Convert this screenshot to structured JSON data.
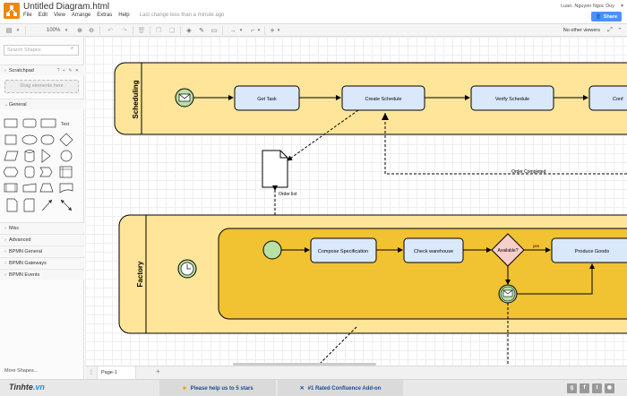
{
  "app": {
    "title": "Untitled Diagram.html",
    "last_change": "Last change less than a minute ago",
    "user": "Luan. Nguyen Ngoc Duy",
    "share_label": "Share",
    "no_viewers": "No other viewers"
  },
  "menu": [
    "File",
    "Edit",
    "View",
    "Arrange",
    "Extras",
    "Help"
  ],
  "toolbar": {
    "zoom": "100%"
  },
  "sidebar": {
    "search_placeholder": "Search Shapes",
    "scratchpad": "Scratchpad",
    "drag_here": "Drag elements here",
    "general": "General",
    "text_shape": "Text",
    "sections": [
      "Misc",
      "Advanced",
      "BPMN General",
      "BPMN Gateways",
      "BPMN Events"
    ],
    "more_shapes": "More Shapes..."
  },
  "diagram": {
    "lanes": [
      "Scheduling",
      "Factory"
    ],
    "tasks": {
      "get_task": "Get Task",
      "create_schedule": "Create Schedule",
      "verify_schedule": "Verify Schedule",
      "confirm": "Conf",
      "compose_spec": "Compose Specification",
      "check_warehouse": "Check warehouse",
      "available": "Available?",
      "produce_goods": "Produce Goods"
    },
    "labels": {
      "order_list": "Order list",
      "order_completed": "Order Completed",
      "yes": "yes"
    }
  },
  "pages": {
    "tab": "Page-1"
  },
  "footer": {
    "brand": "Tinhte",
    "brand_suffix": ".vn",
    "promo1": "Please help us to 5 stars",
    "promo2": "#1 Rated Confluence Add-on"
  },
  "colors": {
    "lane_fill": "#ffe599",
    "subprocess_fill": "#f1c232",
    "task_fill": "#dae8fc",
    "gateway_fill": "#f8cecc",
    "event_fill": "#b9e0a5",
    "accent": "#f08705",
    "share": "#4d90fe"
  }
}
